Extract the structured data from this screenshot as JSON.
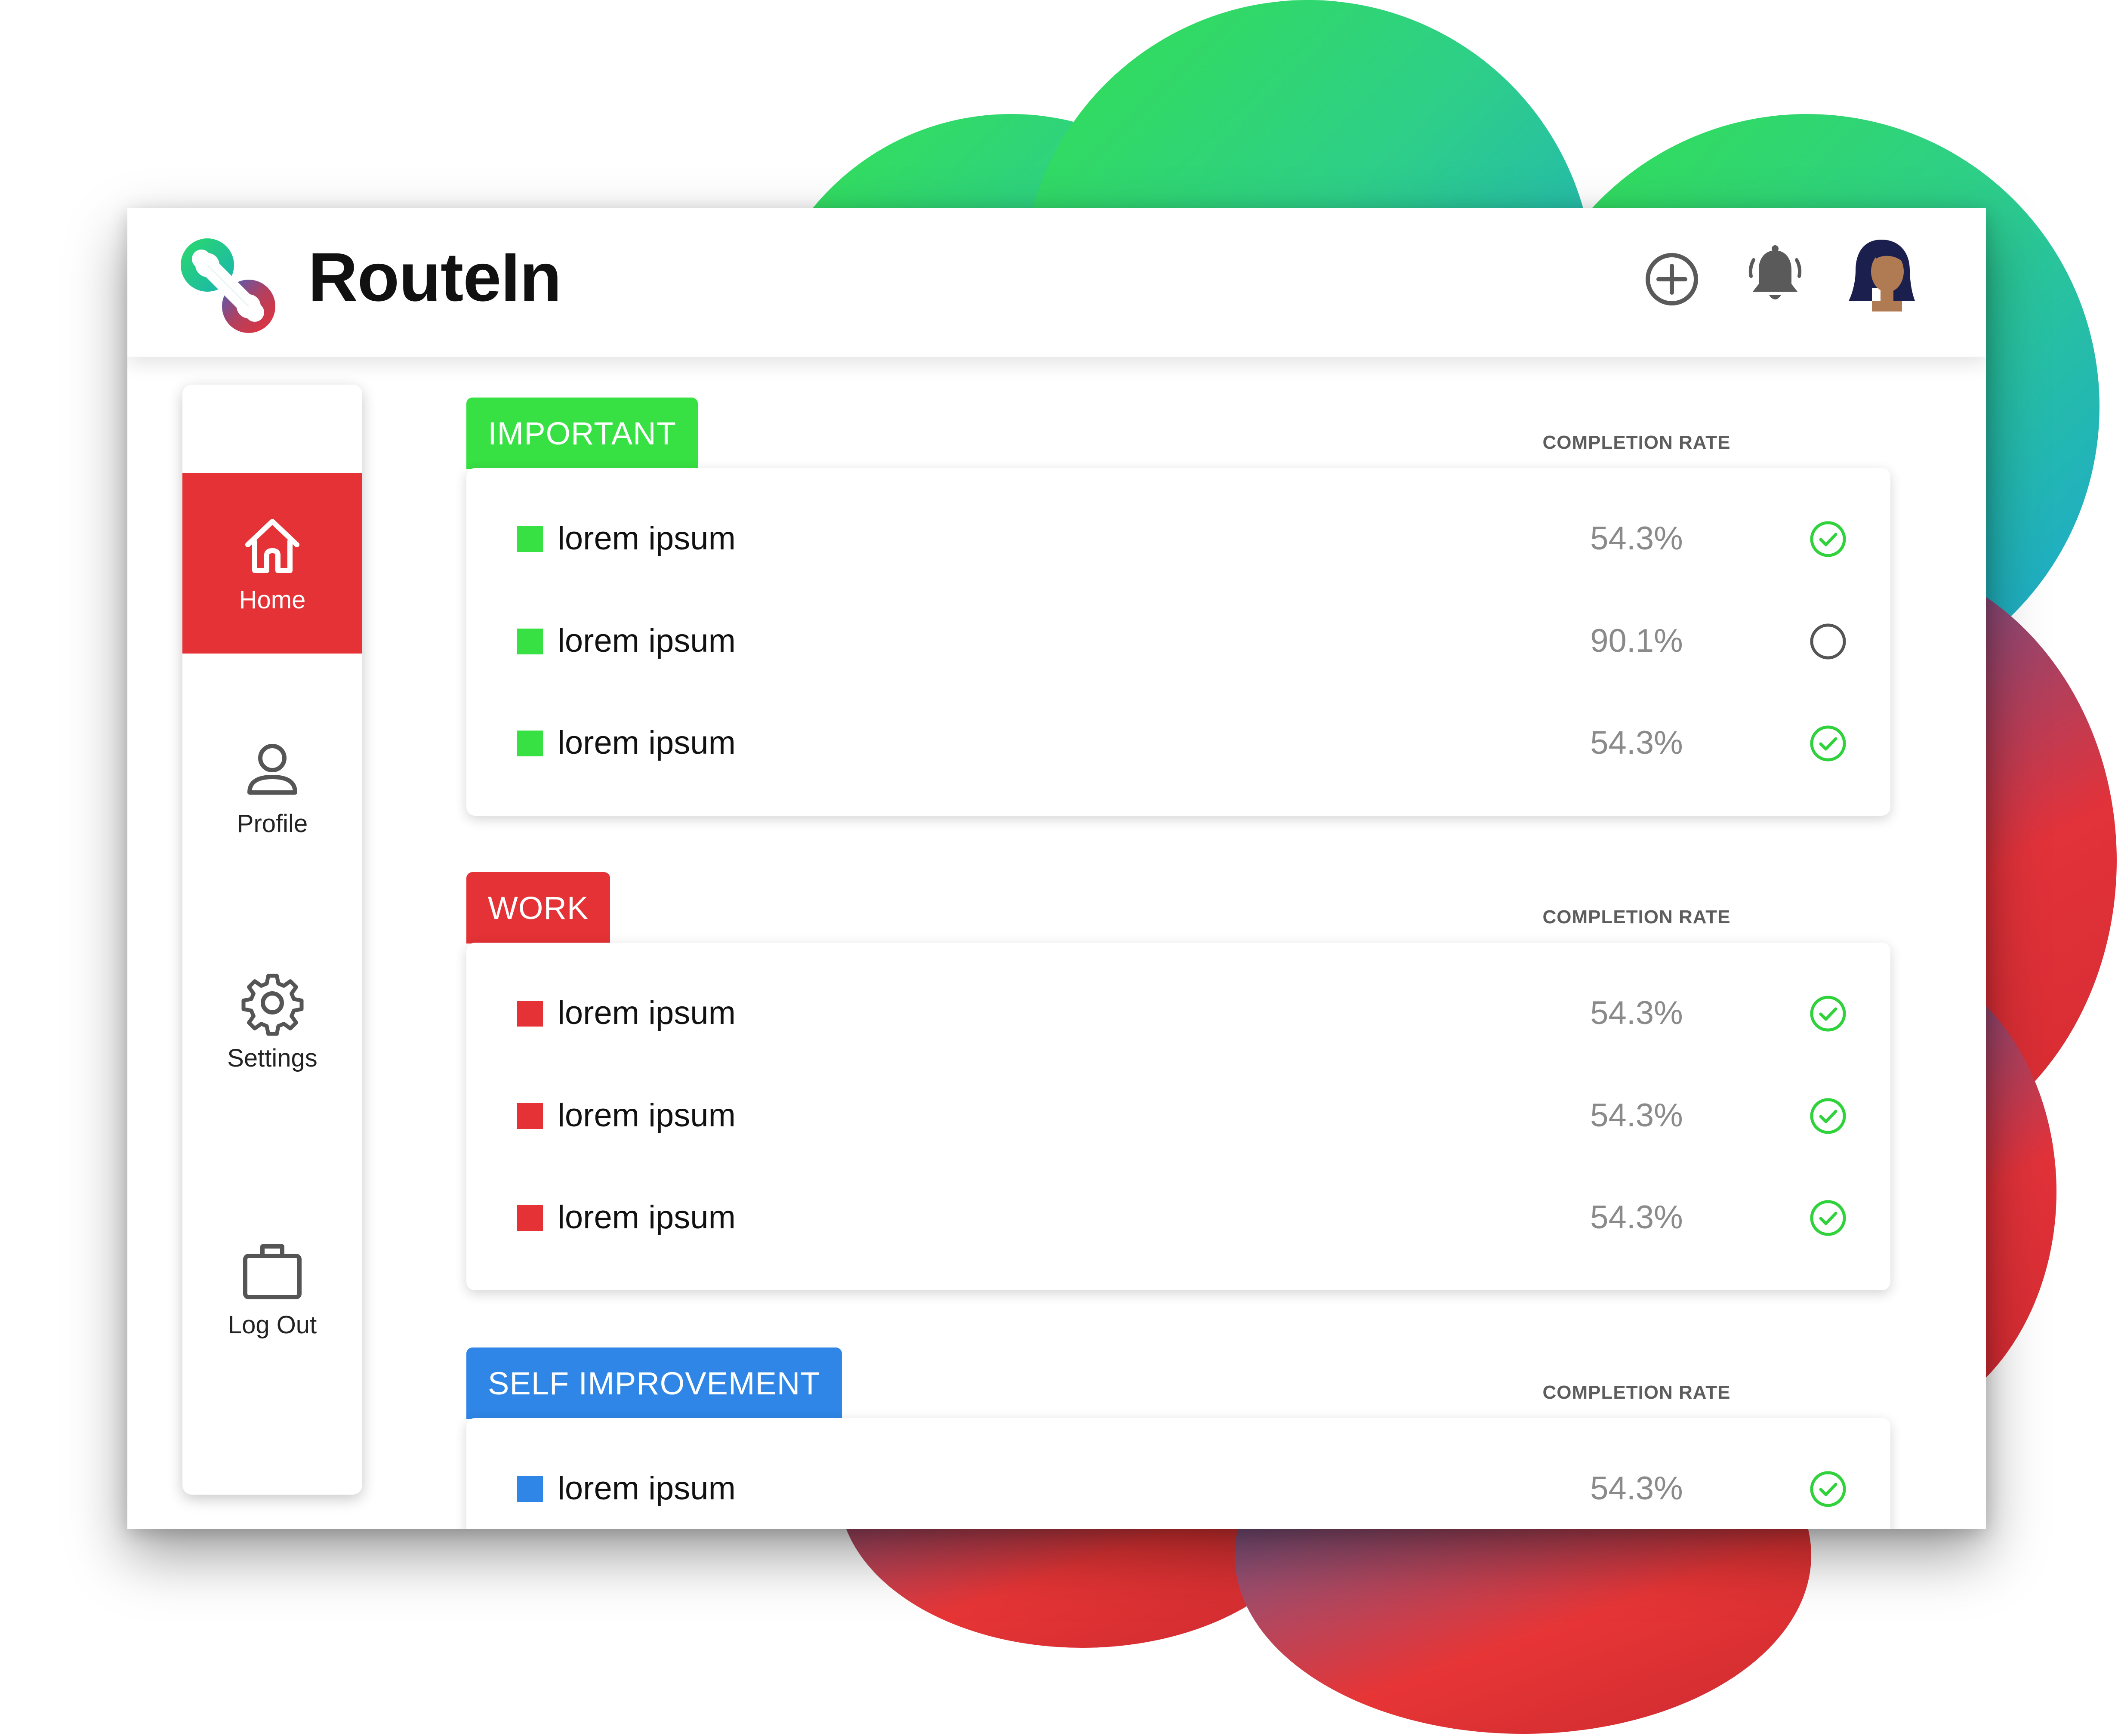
{
  "app": {
    "name": "RouteIn"
  },
  "topbar": {
    "icons": [
      "add-icon",
      "bell-icon",
      "avatar"
    ]
  },
  "sidebar": {
    "items": [
      {
        "label": "Home",
        "icon": "home-icon",
        "active": true
      },
      {
        "label": "Profile",
        "icon": "person-icon",
        "active": false
      },
      {
        "label": "Settings",
        "icon": "gear-icon",
        "active": false
      },
      {
        "label": "Log Out",
        "icon": "briefcase-icon",
        "active": false
      }
    ]
  },
  "sections": [
    {
      "title": "IMPORTANT",
      "color": "#37e043",
      "rate_label": "COMPLETION RATE",
      "rows": [
        {
          "label": "lorem ipsum",
          "rate": "54.3%",
          "done": true
        },
        {
          "label": "lorem ipsum",
          "rate": "90.1%",
          "done": false
        },
        {
          "label": "lorem ipsum",
          "rate": "54.3%",
          "done": true
        }
      ]
    },
    {
      "title": "WORK",
      "color": "#e43236",
      "rate_label": "COMPLETION RATE",
      "rows": [
        {
          "label": "lorem ipsum",
          "rate": "54.3%",
          "done": true
        },
        {
          "label": "lorem ipsum",
          "rate": "54.3%",
          "done": true
        },
        {
          "label": "lorem ipsum",
          "rate": "54.3%",
          "done": true
        }
      ]
    },
    {
      "title": "SELF IMPROVEMENT",
      "color": "#2f86e6",
      "rate_label": "COMPLETION RATE",
      "rows": [
        {
          "label": "lorem ipsum",
          "rate": "54.3%",
          "done": true
        }
      ]
    }
  ],
  "colors": {
    "accent_red": "#e43236",
    "accent_green": "#37e043",
    "accent_blue": "#2f86e6",
    "check_green": "#2fd23b",
    "pending_gray": "#555555"
  }
}
